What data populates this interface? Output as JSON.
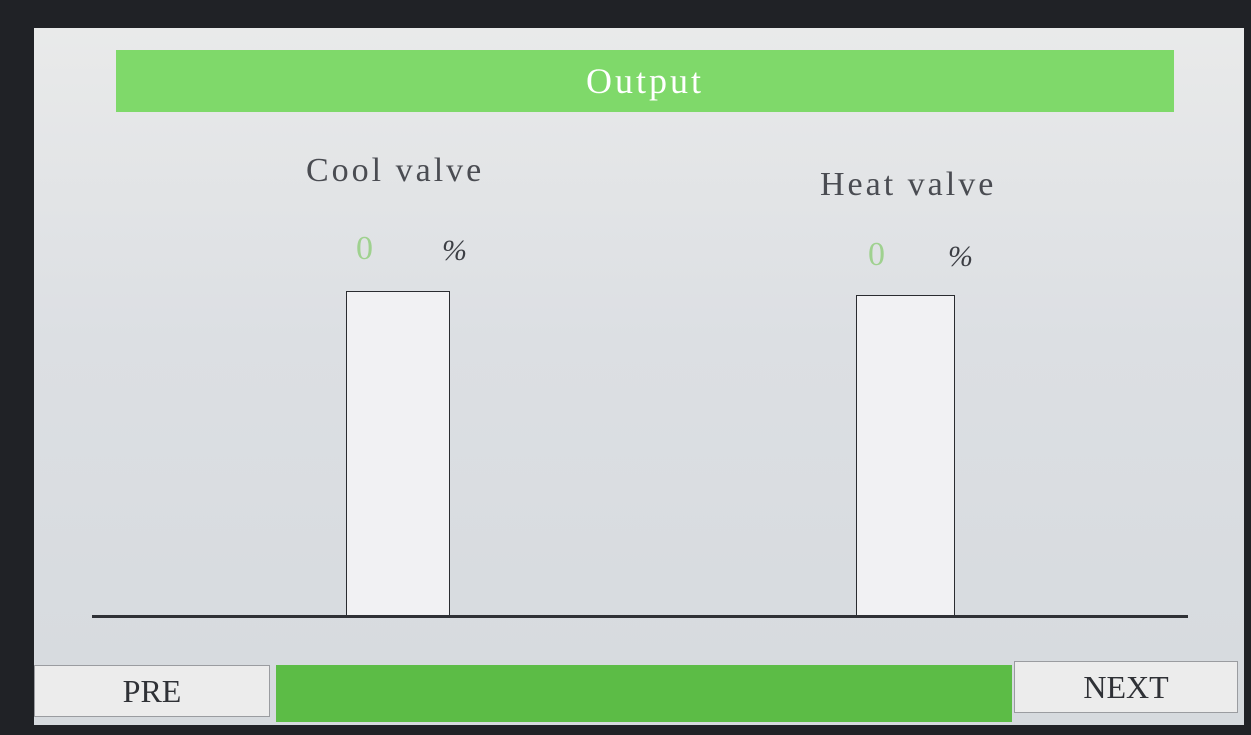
{
  "screen": {
    "title": "Output"
  },
  "valves": [
    {
      "label": "Cool valve",
      "value": "0",
      "unit": "%",
      "level_percent": 0
    },
    {
      "label": "Heat valve",
      "value": "0",
      "unit": "%",
      "level_percent": 0
    }
  ],
  "navigation": {
    "prev_label": "PRE",
    "next_label": "NEXT"
  },
  "colors": {
    "title_bar": "#7fd96a",
    "status_bar": "#5cbc46",
    "value_text": "#9fd18f",
    "bar_fill": "#5fb84a"
  }
}
